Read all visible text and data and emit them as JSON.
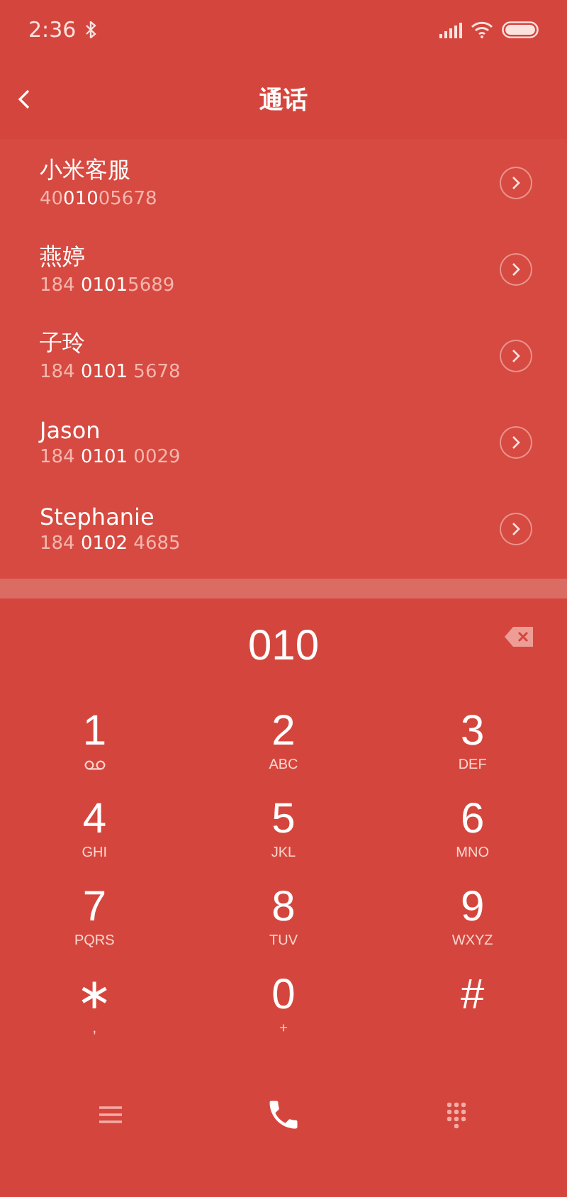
{
  "status_bar": {
    "time": "2:36"
  },
  "header": {
    "title": "通话"
  },
  "contacts": [
    {
      "name": "小米客服",
      "number": "40**010**05678"
    },
    {
      "name": "燕婷",
      "number": "184 **0101**5689"
    },
    {
      "name": "子玲",
      "number": "184 **0101** 5678"
    },
    {
      "name": "Jason",
      "number": "184 **0101** 0029"
    },
    {
      "name": "Stephanie",
      "number": "184 **0102** 4685"
    }
  ],
  "dial_input": {
    "value": "010"
  },
  "keys": [
    {
      "digit": "1",
      "kind": "voicemail"
    },
    {
      "digit": "2",
      "kind": "letters",
      "letters": "ABC"
    },
    {
      "digit": "3",
      "kind": "letters",
      "letters": "DEF"
    },
    {
      "digit": "4",
      "kind": "letters",
      "letters": "GHI"
    },
    {
      "digit": "5",
      "kind": "letters",
      "letters": "JKL"
    },
    {
      "digit": "6",
      "kind": "letters",
      "letters": "MNO"
    },
    {
      "digit": "7",
      "kind": "letters",
      "letters": "PQRS"
    },
    {
      "digit": "8",
      "kind": "letters",
      "letters": "TUV"
    },
    {
      "digit": "9",
      "kind": "letters",
      "letters": "WXYZ"
    },
    {
      "digit": "∗",
      "kind": "letters",
      "letters": ","
    },
    {
      "digit": "0",
      "kind": "letters",
      "letters": "+"
    },
    {
      "digit": "#",
      "kind": "plain"
    }
  ]
}
